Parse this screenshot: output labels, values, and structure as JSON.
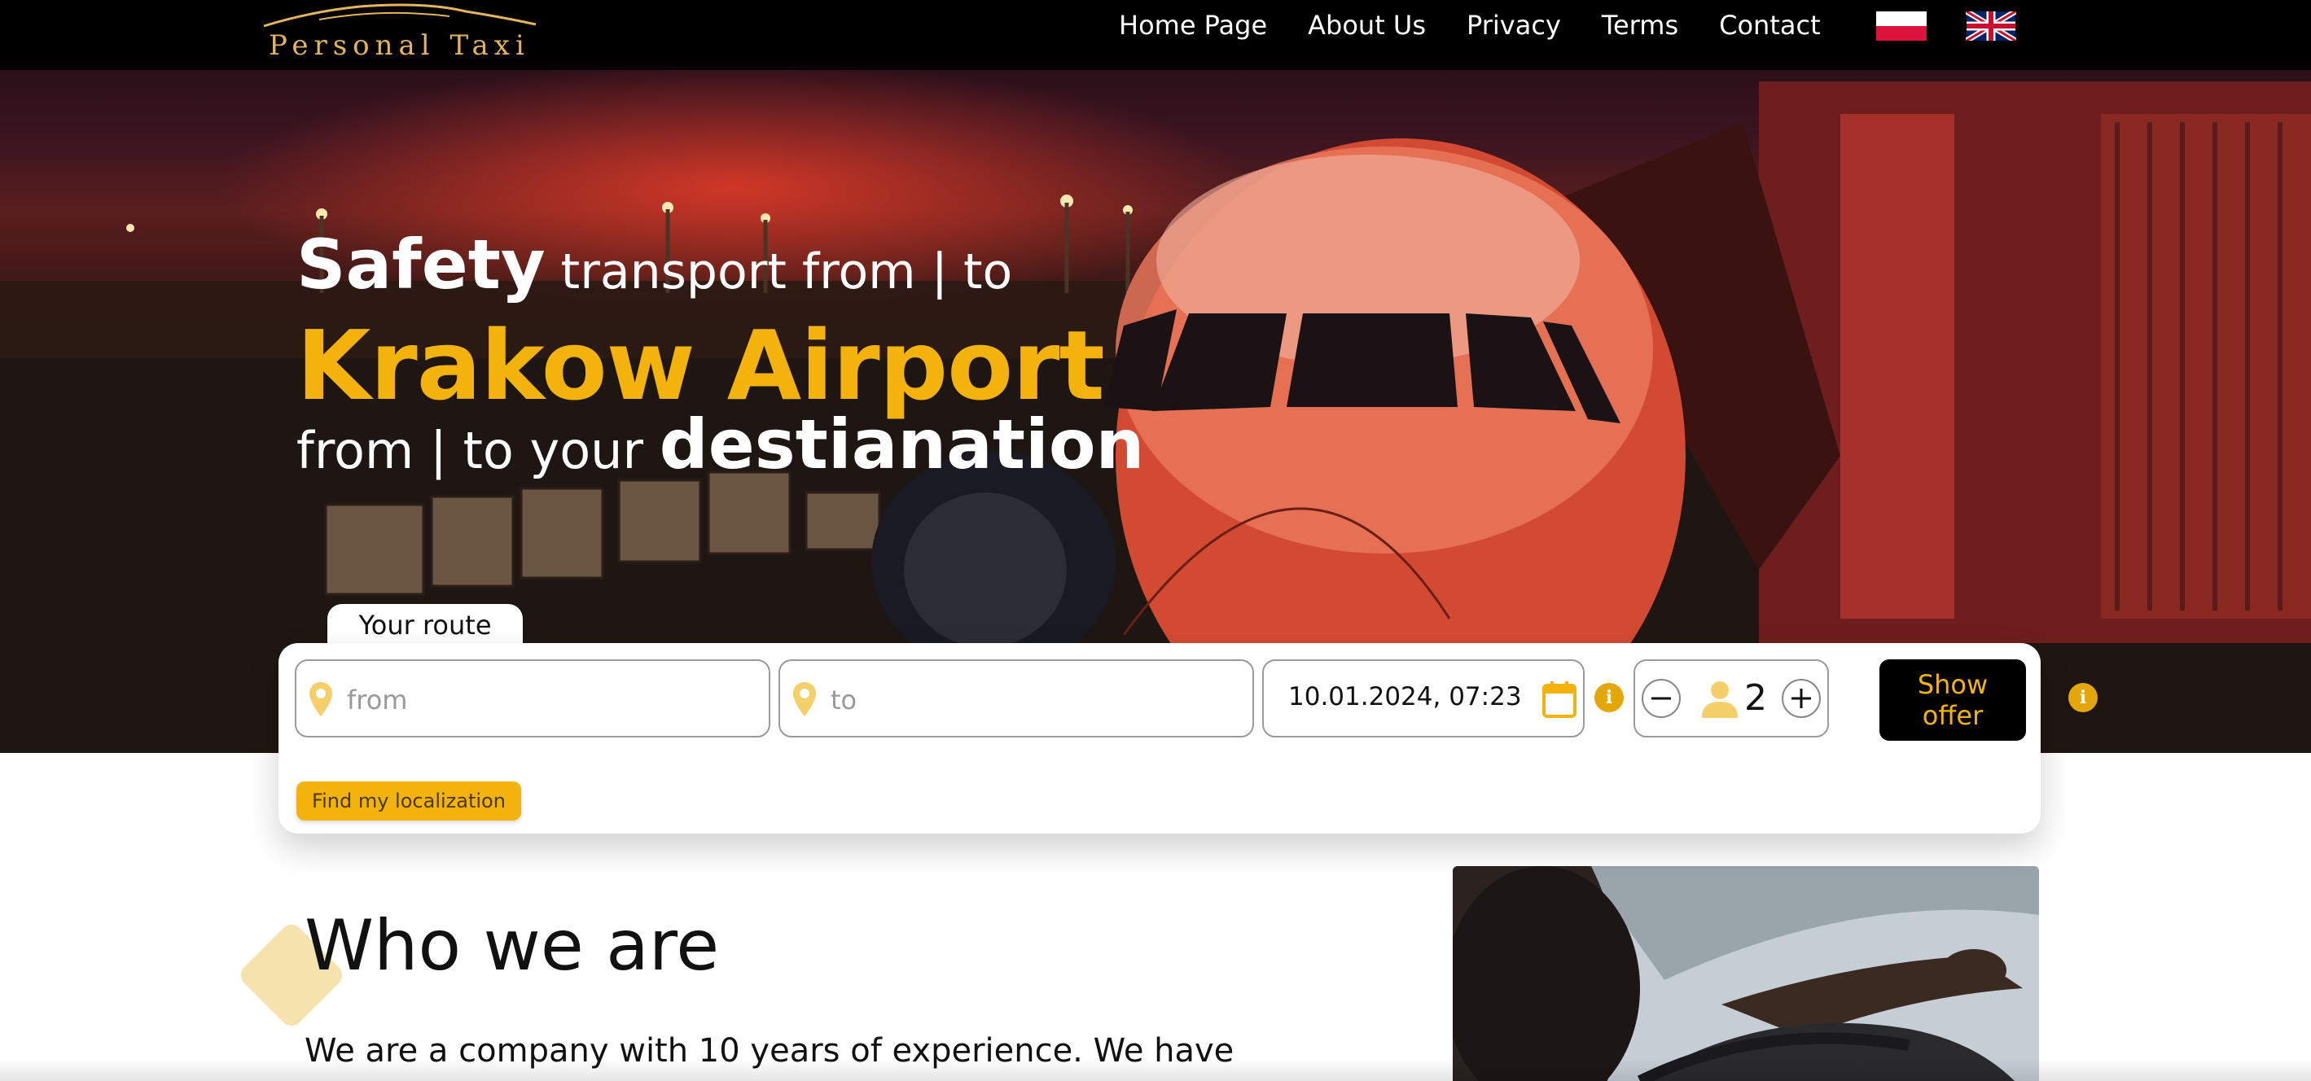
{
  "header": {
    "logo_text": "Personal Taxi",
    "nav": [
      "Home Page",
      "About Us",
      "Privacy",
      "Terms",
      "Contact"
    ],
    "flags": [
      "pl-flag-icon",
      "uk-flag-icon"
    ]
  },
  "hero": {
    "line1_bold": "Safety",
    "line1_rest": " transport from | to",
    "line2": "Krakow Airport",
    "line3_rest": "from | to your ",
    "line3_bold": "destianation"
  },
  "route": {
    "tab_label": "Your route",
    "from_placeholder": "from",
    "to_placeholder": "to",
    "datetime": "10.01.2024, 07:23",
    "passengers": "2",
    "show_offer_label": "Show offer",
    "find_location_label": "Find my localization",
    "info_glyph": "i"
  },
  "about": {
    "title": "Who we are",
    "text": "We are a company with 10 years of experience. We have"
  },
  "colors": {
    "accent": "#f3b30c",
    "header_bg": "#000000",
    "button_bg": "#000000"
  }
}
